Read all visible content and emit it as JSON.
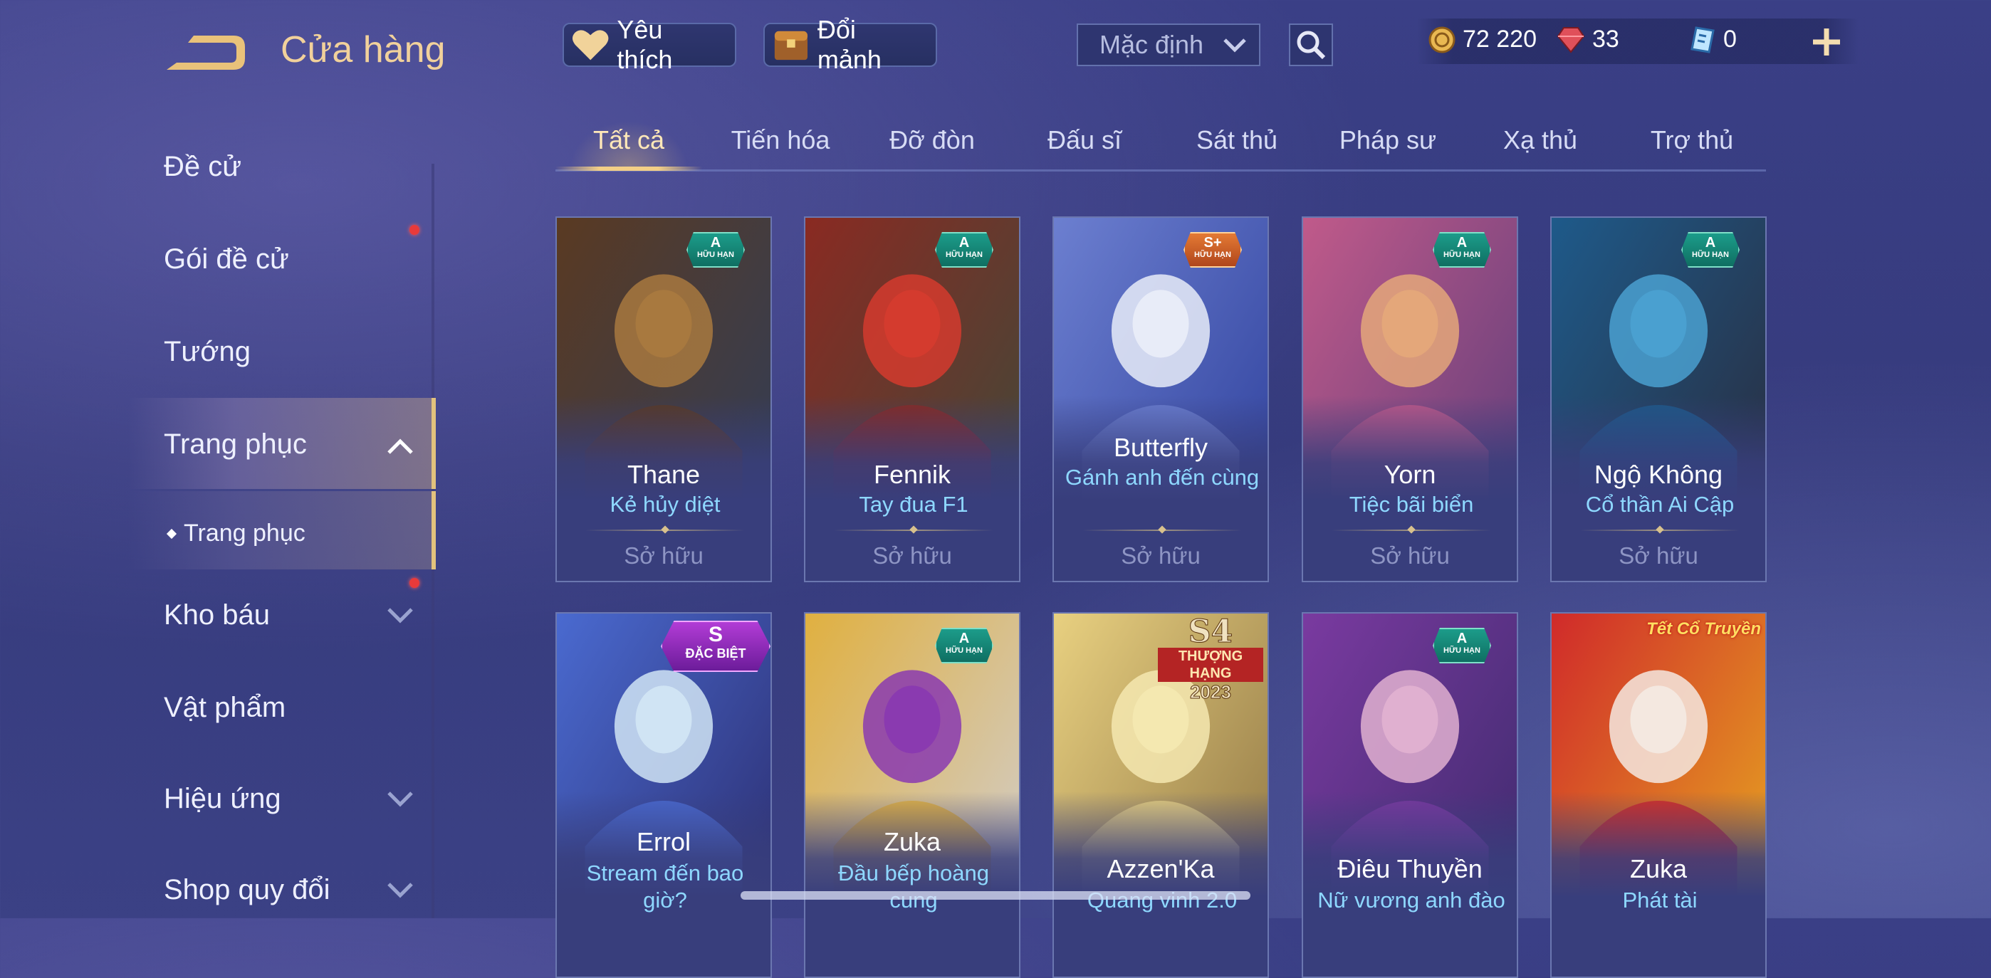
{
  "header": {
    "title": "Cửa hàng",
    "favorite_label": "Yêu thích",
    "exchange_label": "Đổi mảnh",
    "sort_value": "Mặc định",
    "currency": {
      "gold": "72 220",
      "ruby": "33",
      "voucher": "0"
    }
  },
  "sidebar": {
    "items": [
      {
        "label": "Đề cử"
      },
      {
        "label": "Gói đề cử"
      },
      {
        "label": "Tướng"
      },
      {
        "label": "Trang phục"
      },
      {
        "label": "Trang phục"
      },
      {
        "label": "Kho báu"
      },
      {
        "label": "Vật phẩm"
      },
      {
        "label": "Hiệu ứng"
      },
      {
        "label": "Shop quy đổi"
      }
    ]
  },
  "tabs": [
    "Tất cả",
    "Tiến hóa",
    "Đỡ đòn",
    "Đấu sĩ",
    "Sát thủ",
    "Pháp sư",
    "Xạ thủ",
    "Trợ thủ"
  ],
  "cards": [
    {
      "hero": "Thane",
      "skin": "Kẻ hủy diệt",
      "status": "Sở hữu",
      "badge": "A",
      "badge_sub": "HỮU HẠN",
      "colors": [
        "#5a3a22",
        "#a8793f",
        "#2e3d5a"
      ]
    },
    {
      "hero": "Fennik",
      "skin": "Tay đua F1",
      "status": "Sở hữu",
      "badge": "A",
      "badge_sub": "HỮU HẠN",
      "colors": [
        "#8a2a22",
        "#d43b2e",
        "#3c4a3a"
      ]
    },
    {
      "hero": "Butterfly",
      "skin": "Gánh anh đến cùng",
      "status": "Sở hữu",
      "badge": "S+",
      "badge_sub": "HỮU HẠN",
      "colors": [
        "#6c7fd0",
        "#e8ecf8",
        "#2c3e9a"
      ]
    },
    {
      "hero": "Yorn",
      "skin": "Tiệc bãi biển",
      "status": "Sở hữu",
      "badge": "A",
      "badge_sub": "HỮU HẠN",
      "colors": [
        "#c05a8a",
        "#e4a77a",
        "#5a3c7a"
      ]
    },
    {
      "hero": "Ngộ Không",
      "skin": "Cổ thần Ai Cập",
      "status": "Sở hữu",
      "badge": "A",
      "badge_sub": "HỮU HẠN",
      "colors": [
        "#1e5a8a",
        "#4aa0d0",
        "#2a2a3a"
      ]
    },
    {
      "hero": "Errol",
      "skin": "Stream đến bao giờ?",
      "badge": "S",
      "badge_sub": "ĐẶC BIỆT",
      "colors": [
        "#4a6ad0",
        "#d0e4f4",
        "#2a2a6a"
      ]
    },
    {
      "hero": "Zuka",
      "skin": "Đầu bếp hoàng cung",
      "badge": "A",
      "badge_sub": "HỮU HẠN",
      "colors": [
        "#e0b040",
        "#8a3ab0",
        "#d0d0d8"
      ]
    },
    {
      "hero": "Azzen'Ka",
      "skin": "Quang vinh 2.0",
      "rank": {
        "season": "S4",
        "label": "THƯỢNG HẠNG",
        "year": "2023"
      },
      "colors": [
        "#e8d080",
        "#f4e8b0",
        "#8a7040"
      ]
    },
    {
      "hero": "Điêu Thuyền",
      "skin": "Nữ vương anh đào",
      "badge": "A",
      "badge_sub": "HỮU HẠN",
      "colors": [
        "#7a3aa0",
        "#e0b0d0",
        "#3a2a6a"
      ]
    },
    {
      "hero": "Zuka",
      "skin": "Phát tài",
      "event_badge": "Tết Cổ Truyền",
      "colors": [
        "#d02a2a",
        "#f4e8e0",
        "#e8b020"
      ]
    }
  ],
  "icons": {
    "back": "back-arrow-icon",
    "heart": "heart-icon",
    "chest": "chest-icon",
    "search": "search-icon",
    "gold": "gold-coin-icon",
    "ruby": "ruby-gem-icon",
    "voucher": "voucher-icon",
    "add": "plus-icon"
  }
}
